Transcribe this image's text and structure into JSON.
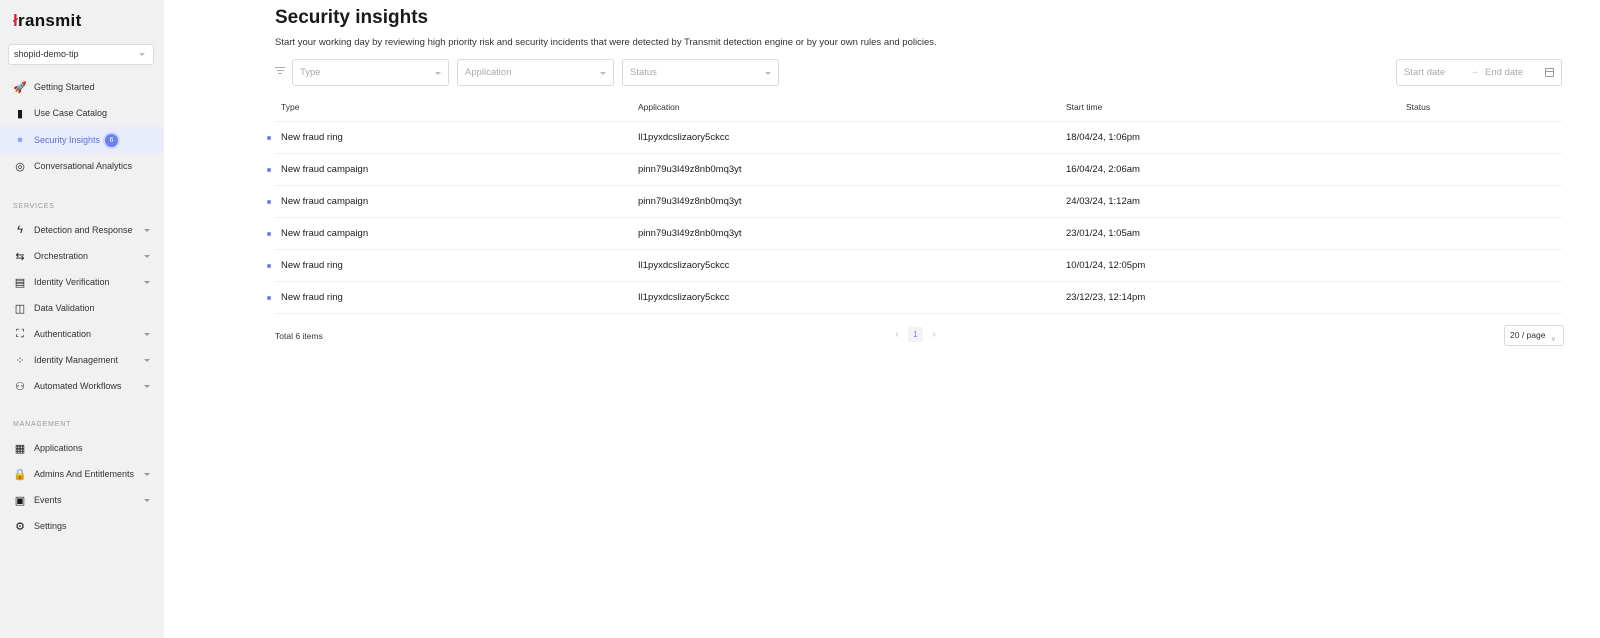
{
  "app": {
    "logo_prefix": "ł",
    "logo_text": "ransmit",
    "tenant": "shopid-demo-tip"
  },
  "sidebar": {
    "top_items": [
      {
        "label": "Getting Started",
        "icon": "rocket-icon"
      },
      {
        "label": "Use Case Catalog",
        "icon": "catalog-icon"
      },
      {
        "label": "Security Insights",
        "icon": "lightbulb-icon",
        "badge": "6",
        "active": true
      },
      {
        "label": "Conversational Analytics",
        "icon": "analytics-icon"
      }
    ],
    "services_header": "SERVICES",
    "services": [
      {
        "label": "Detection and Response",
        "icon": "lightning-icon",
        "expandable": true
      },
      {
        "label": "Orchestration",
        "icon": "orchestration-icon",
        "expandable": true
      },
      {
        "label": "Identity Verification",
        "icon": "id-card-icon",
        "expandable": true
      },
      {
        "label": "Data Validation",
        "icon": "data-validation-icon",
        "expandable": false
      },
      {
        "label": "Authentication",
        "icon": "scan-frame-icon",
        "expandable": true
      },
      {
        "label": "Identity Management",
        "icon": "identity-management-icon",
        "expandable": true
      },
      {
        "label": "Automated Workflows",
        "icon": "workflow-icon",
        "expandable": true
      }
    ],
    "management_header": "MANAGEMENT",
    "management": [
      {
        "label": "Applications",
        "icon": "grid-icon",
        "expandable": false
      },
      {
        "label": "Admins And Entitlements",
        "icon": "lock-icon",
        "expandable": true
      },
      {
        "label": "Events",
        "icon": "calendar-icon",
        "expandable": true
      },
      {
        "label": "Settings",
        "icon": "gears-icon",
        "expandable": false
      }
    ]
  },
  "page": {
    "title": "Security insights",
    "subtitle": "Start your working day by reviewing high priority risk and security incidents that were detected by Transmit detection engine or by your own rules and policies."
  },
  "filters": {
    "type_placeholder": "Type",
    "application_placeholder": "Application",
    "status_placeholder": "Status",
    "start_date_placeholder": "Start date",
    "end_date_placeholder": "End date",
    "range_arrow": "→"
  },
  "table": {
    "headers": {
      "type": "Type",
      "application": "Application",
      "start_time": "Start time",
      "status": "Status"
    },
    "rows": [
      {
        "type": "New fraud ring",
        "application": "Il1pyxdcslizaory5ckcc",
        "start_time": "18/04/24, 1:06pm",
        "status": ""
      },
      {
        "type": "New fraud campaign",
        "application": "pinn79u3l49z8nb0mq3yt",
        "start_time": "16/04/24, 2:06am",
        "status": ""
      },
      {
        "type": "New fraud campaign",
        "application": "pinn79u3l49z8nb0mq3yt",
        "start_time": "24/03/24, 1:12am",
        "status": ""
      },
      {
        "type": "New fraud campaign",
        "application": "pinn79u3l49z8nb0mq3yt",
        "start_time": "23/01/24, 1:05am",
        "status": ""
      },
      {
        "type": "New fraud ring",
        "application": "Il1pyxdcslizaory5ckcc",
        "start_time": "10/01/24, 12:05pm",
        "status": ""
      },
      {
        "type": "New fraud ring",
        "application": "Il1pyxdcslizaory5ckcc",
        "start_time": "23/12/23, 12:14pm",
        "status": ""
      }
    ]
  },
  "pagination": {
    "total": "Total 6 items",
    "current_page": "1",
    "prev": "‹",
    "next": "›",
    "page_size": "20 / page"
  },
  "colors": {
    "accent": "#6b7ff0",
    "sidebar_bg": "#f1f1f1",
    "active_bg": "#e9ecfb",
    "brand_red": "#d6243a"
  }
}
